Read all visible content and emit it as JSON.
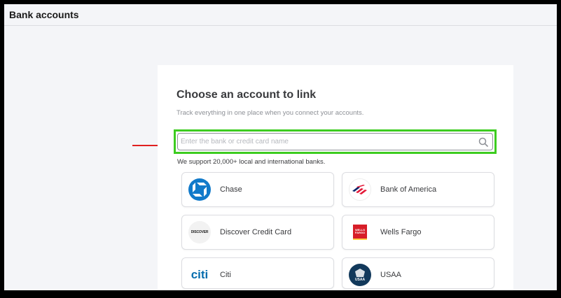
{
  "header": {
    "title": "Bank accounts"
  },
  "panel": {
    "title": "Choose an account to link",
    "subtitle": "Track everything in one place when you connect your accounts."
  },
  "search": {
    "placeholder": "Enter the bank or credit card name",
    "value": "",
    "icon": "search-icon"
  },
  "support_note": "We support 20,000+ local and international banks.",
  "banks": [
    {
      "name": "Chase",
      "logo_text": "",
      "icon": "chase-logo-icon"
    },
    {
      "name": "Bank of America",
      "logo_text": "",
      "icon": "bank-of-america-logo-icon"
    },
    {
      "name": "Discover Credit Card",
      "logo_text": "DISCOVER",
      "icon": "discover-logo-icon"
    },
    {
      "name": "Wells Fargo",
      "logo_text": "WELLS FARGO",
      "icon": "wells-fargo-logo-icon"
    },
    {
      "name": "Citi",
      "logo_text": "citi",
      "icon": "citi-logo-icon"
    },
    {
      "name": "USAA",
      "logo_text": "USAA",
      "icon": "usaa-logo-icon"
    }
  ],
  "colors": {
    "highlight": "#3dcc20",
    "arrow": "#e02020",
    "chase": "#117aca",
    "bank_of_america": "#e31837",
    "wells_fargo": "#d71e28",
    "citi": "#056dae",
    "usaa": "#12395b"
  }
}
